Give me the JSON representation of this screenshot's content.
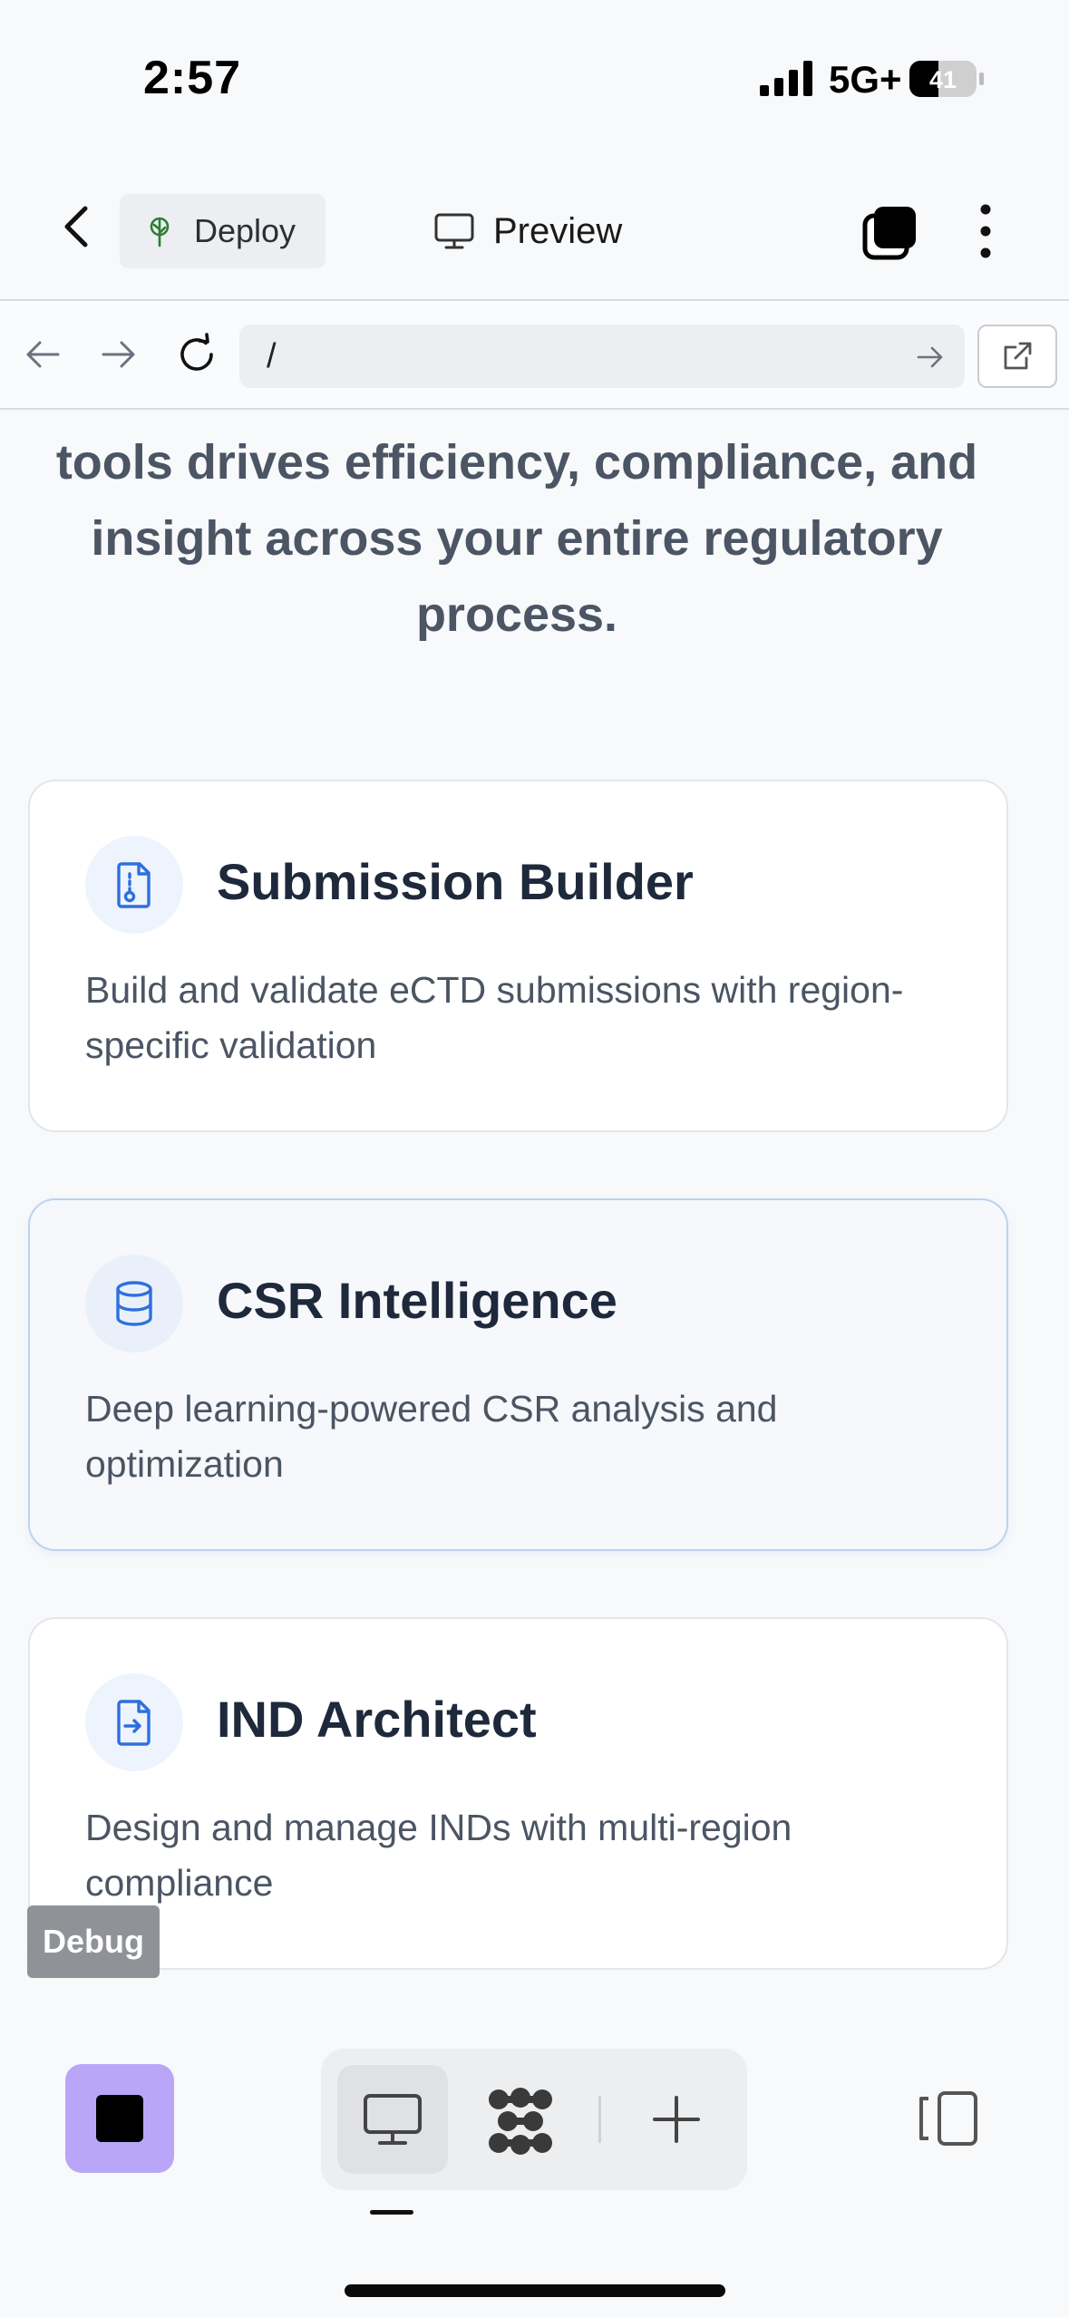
{
  "status_bar": {
    "time": "2:57",
    "network": "5G+",
    "battery": "41"
  },
  "topbar": {
    "deploy_label": "Deploy",
    "preview_label": "Preview"
  },
  "urlbar": {
    "url": "/"
  },
  "content": {
    "intro": "tools drives efficiency, compliance, and insight across your entire regulatory process.",
    "cards": [
      {
        "title": "Submission Builder",
        "description": "Build and validate eCTD submissions with region-specific validation",
        "icon": "file-cog-icon"
      },
      {
        "title": "CSR Intelligence",
        "description": "Deep learning-powered CSR analysis and optimization",
        "icon": "database-icon"
      },
      {
        "title": "IND Architect",
        "description": "Design and manage INDs with multi-region compliance",
        "icon": "file-input-icon"
      }
    ]
  },
  "debug_label": "Debug",
  "colors": {
    "accent_blue": "#2f6fde",
    "stop_button": "#b9a6f9",
    "deploy_green": "#2e7d32"
  }
}
